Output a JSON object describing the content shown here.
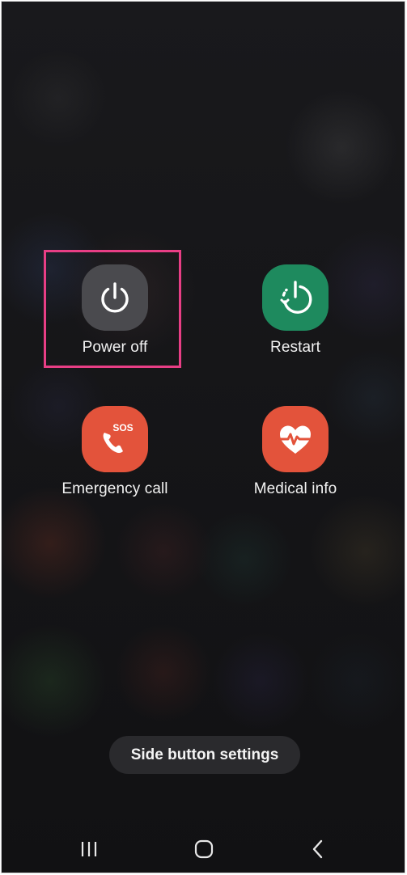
{
  "power_menu": {
    "power_off": {
      "label": "Power off",
      "icon": "power-icon",
      "color": "#4a4a4e"
    },
    "restart": {
      "label": "Restart",
      "icon": "restart-icon",
      "color": "#1e8a5e"
    },
    "emergency_call": {
      "label": "Emergency call",
      "icon": "phone-sos-icon",
      "badge": "SOS",
      "color": "#e3533b"
    },
    "medical_info": {
      "label": "Medical info",
      "icon": "heart-pulse-icon",
      "color": "#e3533b"
    }
  },
  "side_button": {
    "label": "Side button settings"
  },
  "navbar": {
    "recents": {
      "icon": "recents-icon"
    },
    "home": {
      "icon": "home-icon"
    },
    "back": {
      "icon": "back-icon"
    }
  },
  "highlight_color": "#e83e85"
}
